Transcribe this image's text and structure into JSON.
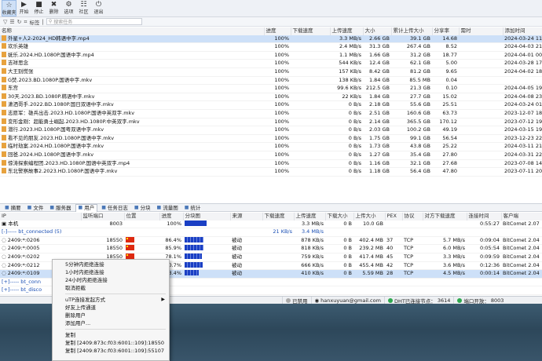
{
  "toolbar": [
    {
      "icon": "star-icon",
      "glyph": "☆",
      "label": "收藏夹"
    },
    {
      "icon": "play-icon",
      "glyph": "▶",
      "label": "开始"
    },
    {
      "icon": "stop-icon",
      "glyph": "■",
      "label": "停止"
    },
    {
      "icon": "delete-icon",
      "glyph": "✖",
      "label": "删除"
    },
    {
      "icon": "gear-icon",
      "glyph": "⚙",
      "label": "选项"
    },
    {
      "icon": "community-icon",
      "glyph": "☷",
      "label": "社区"
    },
    {
      "icon": "power-icon",
      "glyph": "⏻",
      "label": "退出"
    }
  ],
  "filterbar": {
    "tag_label": "标签",
    "search_placeholder": "搜索任务"
  },
  "tasks": {
    "headers": [
      "名称",
      "进度",
      "下载速度",
      "上传速度",
      "大小",
      "累计上传大小",
      "分享率",
      "需时",
      "添加时间"
    ],
    "rows": [
      {
        "name": "外星+人2-2024_HD韩语中字.mp4",
        "progress": "100%",
        "down": "",
        "up": "3.3 MB/s",
        "size": "2.66 GB",
        "total_up": "39.1 GB",
        "ratio": "14.68",
        "eta": "",
        "added": "2024-03-24 11:47:30"
      },
      {
        "name": "欢乐英雄",
        "progress": "100%",
        "down": "",
        "up": "2.4 MB/s",
        "size": "31.3 GB",
        "total_up": "267.4 GB",
        "ratio": "8.52",
        "eta": "",
        "added": "2024-04-03 21:22:59"
      },
      {
        "name": "妩乐.2024.HD.1080P.国语中字.mp4",
        "progress": "100%",
        "down": "",
        "up": "1.1 MB/s",
        "size": "1.66 GB",
        "total_up": "31.2 GB",
        "ratio": "18.77",
        "eta": "",
        "added": "2024-04-01 00:01:45"
      },
      {
        "name": "吉祥思念",
        "progress": "100%",
        "down": "",
        "up": "544 KB/s",
        "size": "12.4 GB",
        "total_up": "62.1 GB",
        "ratio": "5.00",
        "eta": "",
        "added": "2024-03-28 17:53:35"
      },
      {
        "name": "大王别慌张",
        "progress": "100%",
        "down": "",
        "up": "157 KB/s",
        "size": "8.42 GB",
        "total_up": "81.2 GB",
        "ratio": "9.65",
        "eta": "",
        "added": "2024-04-02 18:02:34"
      },
      {
        "name": "G焚.2023.BD.1080P.国语中字.mkv",
        "progress": "100%",
        "down": "",
        "up": "138 KB/s",
        "size": "1.84 GB",
        "total_up": "85.5 MB",
        "ratio": "0.04",
        "eta": "",
        "added": ""
      },
      {
        "name": "东宫",
        "progress": "100%",
        "down": "",
        "up": "99.6 KB/s",
        "size": "212.5 GB",
        "total_up": "21.3 GB",
        "ratio": "0.10",
        "eta": "",
        "added": "2024-04-05 19:52:49"
      },
      {
        "name": "30天.2023.BD.1080P.韩语中字.mkv",
        "progress": "100%",
        "down": "",
        "up": "22 KB/s",
        "size": "1.84 GB",
        "total_up": "27.7 GB",
        "ratio": "15.02",
        "eta": "",
        "added": "2024-04-08 23:53:33"
      },
      {
        "name": "潇洒哥手.2022.BD.1080P.国日双语中字.mkv",
        "progress": "100%",
        "down": "",
        "up": "0 B/s",
        "size": "2.18 GB",
        "total_up": "55.6 GB",
        "ratio": "25.51",
        "eta": "",
        "added": "2024-03-24 01:49:53"
      },
      {
        "name": "志愿军：雄兵出击.2023.HD.1080P.国语中英双字.mkv",
        "progress": "100%",
        "down": "",
        "up": "0 B/s",
        "size": "2.51 GB",
        "total_up": "160.6 GB",
        "ratio": "63.73",
        "eta": "",
        "added": "2023-12-07 18:59:40"
      },
      {
        "name": "变形金刚：超能勇士崛起.2023.HD.1080P.中英双字.mkv",
        "progress": "100%",
        "down": "",
        "up": "0 B/s",
        "size": "2.14 GB",
        "total_up": "365.5 GB",
        "ratio": "170.12",
        "eta": "",
        "added": "2023-07-12 19:03:33"
      },
      {
        "name": "潜行.2023.HD.1080P.国粤双语中字.mkv",
        "progress": "100%",
        "down": "",
        "up": "0 B/s",
        "size": "2.03 GB",
        "total_up": "100.2 GB",
        "ratio": "49.19",
        "eta": "",
        "added": "2024-03-15 19:16:23"
      },
      {
        "name": "看不见的朋友.2023.HD.1080P.国语中字.mkv",
        "progress": "100%",
        "down": "",
        "up": "0 B/s",
        "size": "1.75 GB",
        "total_up": "99.1 GB",
        "ratio": "56.54",
        "eta": "",
        "added": "2023-12-23 22:22:19"
      },
      {
        "name": "临时劫案.2024.HD.1080P.国语中字.mkv",
        "progress": "100%",
        "down": "",
        "up": "0 B/s",
        "size": "1.73 GB",
        "total_up": "43.8 GB",
        "ratio": "25.22",
        "eta": "",
        "added": "2024-03-11 21:58:50"
      },
      {
        "name": "回爸.2024.HD.1080P.国语中字.mkv",
        "progress": "100%",
        "down": "",
        "up": "0 B/s",
        "size": "1.27 GB",
        "total_up": "35.4 GB",
        "ratio": "27.80",
        "eta": "",
        "added": "2024-03-31 22:03:45"
      },
      {
        "name": "惊涛探索编程团.2023.HD.1080P.国语中英双字.mp4",
        "progress": "100%",
        "down": "",
        "up": "0 B/s",
        "size": "1.16 GB",
        "total_up": "32.1 GB",
        "ratio": "27.68",
        "eta": "",
        "added": "2023-07-08 14:49:50"
      },
      {
        "name": "东北警察故事2.2023.HD.1080P.国语中字.mkv",
        "progress": "100%",
        "down": "",
        "up": "0 B/s",
        "size": "1.18 GB",
        "total_up": "56.4 GB",
        "ratio": "47.80",
        "eta": "",
        "added": "2023-07-11 20:00:52"
      }
    ]
  },
  "tabs": [
    {
      "icon": "summary-icon",
      "label": "摘要"
    },
    {
      "icon": "file-icon",
      "label": "文件"
    },
    {
      "icon": "server-icon",
      "label": "服务器"
    },
    {
      "icon": "user-icon",
      "label": "用户"
    },
    {
      "icon": "log-icon",
      "label": "任务日志"
    },
    {
      "icon": "block-icon",
      "label": "分块"
    },
    {
      "icon": "traffic-icon",
      "label": "流量图"
    },
    {
      "icon": "stats-icon",
      "label": "统计"
    }
  ],
  "peers": {
    "headers": [
      "IP",
      "监听端口",
      "位置",
      "进度",
      "分块图",
      "来源",
      "下载速度",
      "上传速度",
      "下载大小",
      "上传大小",
      "PEX",
      "协议",
      "对方下载速度",
      "连接时间",
      "客户端"
    ],
    "rows": [
      {
        "ip": "本机",
        "port": "8003",
        "loc": "",
        "flag": false,
        "progress": "100%",
        "block": 1.0,
        "solid": true,
        "src": "",
        "down": "",
        "up": "3.3 MB/s",
        "dsize": "0 B",
        "usize": "10.0 GB",
        "pex": "",
        "proto": "",
        "peer_down": "",
        "time": "0:55:27",
        "client": "BitComet 2.07"
      },
      {
        "ip": "[-]----- bt_connected (5)",
        "port": "",
        "loc": "",
        "flag": false,
        "progress": "",
        "block": 0,
        "solid": false,
        "src": "",
        "down": "21 KB/s",
        "up": "3.4 MB/s",
        "dsize": "",
        "usize": "",
        "pex": "",
        "proto": "",
        "peer_down": "",
        "time": "",
        "client": "",
        "group": true
      },
      {
        "ip": "2409:*:0206",
        "port": "18550",
        "loc": "",
        "flag": true,
        "progress": "86.4%",
        "block": 0.864,
        "solid": false,
        "src": "被动",
        "down": "",
        "up": "878 KB/s",
        "dsize": "0 B",
        "usize": "402.4 MB",
        "pex": "37",
        "proto": "TCP",
        "peer_down": "5.7 MB/s",
        "time": "0:09:04",
        "client": "BitComet 2.04"
      },
      {
        "ip": "2409:*:0005",
        "port": "18550",
        "loc": "",
        "flag": true,
        "progress": "85.9%",
        "block": 0.859,
        "solid": false,
        "src": "被动",
        "down": "",
        "up": "818 KB/s",
        "dsize": "0 B",
        "usize": "239.2 MB",
        "pex": "40",
        "proto": "TCP",
        "peer_down": "6.0 MB/s",
        "time": "0:05:54",
        "client": "BitComet 2.04"
      },
      {
        "ip": "2409:*:0202",
        "port": "18550",
        "loc": "",
        "flag": true,
        "progress": "78.1%",
        "block": 0.781,
        "solid": false,
        "src": "被动",
        "down": "",
        "up": "759 KB/s",
        "dsize": "0 B",
        "usize": "417.4 MB",
        "pex": "45",
        "proto": "TCP",
        "peer_down": "3.3 MB/s",
        "time": "0:09:59",
        "client": "BitComet 2.04"
      },
      {
        "ip": "2409:*:0212",
        "port": "18550",
        "loc": "",
        "flag": true,
        "progress": "80.7%",
        "block": 0.807,
        "solid": false,
        "src": "被动",
        "down": "",
        "up": "666 KB/s",
        "dsize": "0 B",
        "usize": "455.4 MB",
        "pex": "42",
        "proto": "TCP",
        "peer_down": "3.6 MB/s",
        "time": "0:12:36",
        "client": "BitComet 2.04"
      },
      {
        "ip": "2409:*:0109",
        "port": "18550",
        "loc": "",
        "flag": true,
        "progress": "63.4%",
        "block": 0.634,
        "solid": false,
        "src": "被动",
        "down": "",
        "up": "410 KB/s",
        "dsize": "0 B",
        "usize": "5.59 MB",
        "pex": "28",
        "proto": "TCP",
        "peer_down": "4.5 MB/s",
        "time": "0:00:14",
        "client": "BitComet 2.04",
        "selected": true
      },
      {
        "ip": "[+]----- bt_conn",
        "port": "",
        "loc": "",
        "flag": false,
        "progress": "",
        "block": 0,
        "solid": false,
        "src": "",
        "down": "",
        "up": "",
        "dsize": "",
        "usize": "",
        "pex": "",
        "proto": "",
        "peer_down": "",
        "time": "",
        "client": "",
        "group": true
      },
      {
        "ip": "[+]----- bt_disco",
        "port": "",
        "loc": "",
        "flag": false,
        "progress": "",
        "block": 0,
        "solid": false,
        "src": "",
        "down": "",
        "up": "",
        "dsize": "",
        "usize": "",
        "pex": "",
        "proto": "",
        "peer_down": "",
        "time": "",
        "client": "",
        "group": true
      },
      {
        "ip": "[+]----- bt_bann",
        "port": "",
        "loc": "",
        "flag": false,
        "progress": "",
        "block": 0,
        "solid": false,
        "src": "",
        "down": "",
        "up": "",
        "dsize": "",
        "usize": "",
        "pex": "",
        "proto": "",
        "peer_down": "",
        "time": "",
        "client": "",
        "group": true
      }
    ]
  },
  "statusbar": {
    "disabled": "已禁用",
    "email": "hanxuyuan@gmail.com",
    "dht": "DHT已连接节点：",
    "dht_count": "3614",
    "port_label": "端口开放：",
    "port": "8003"
  },
  "context_menu": {
    "groups": [
      [
        "5分钟内拒绝连接",
        "1小时内拒绝连接",
        "24小时内拒绝连接",
        "取消拒截"
      ],
      [
        "uTP连接发起方式",
        "好友上传通道",
        "删除用户",
        "添加用户..."
      ],
      [
        "复制",
        "复制 [2409:873c:f03:6001::109]:18550",
        "复制 [2409:873c:f03:6001::109]:55107"
      ]
    ],
    "submenu_item": "uTP连接发起方式"
  },
  "colors": {
    "selection": "#cde0f8",
    "block_blue": "#1a3fc4",
    "status_green": "#2fa84f"
  }
}
